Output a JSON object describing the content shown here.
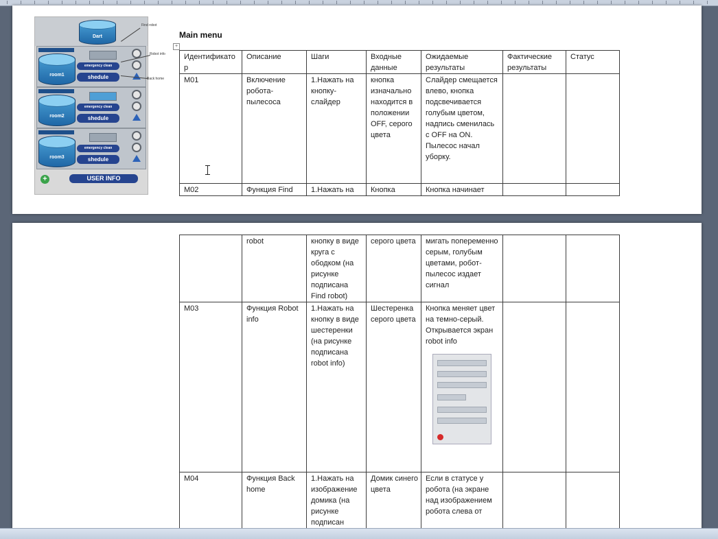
{
  "mockup": {
    "dart_label": "Dart",
    "rooms": [
      {
        "name": "room1",
        "button": "emergency clean",
        "schedule": "shedule"
      },
      {
        "name": "room2",
        "button": "emergency clean",
        "schedule": "shedule"
      },
      {
        "name": "room3",
        "button": "emergency clean",
        "schedule": "shedule"
      }
    ],
    "user_info": "USER INFO",
    "callouts": [
      "Find robot",
      "Robot info",
      "Back home"
    ]
  },
  "heading": "Main menu",
  "table": {
    "headers": [
      "Идентификатор",
      "Описание",
      "Шаги",
      "Входные данные",
      "Ожидаемые результаты",
      "Фактические результаты",
      "Статус"
    ],
    "page1_rows": [
      {
        "id": "M01",
        "desc": "Включение робота-пылесоса",
        "steps": "1.Нажать на кнопку-слайдер",
        "input": "кнопка изначально находится в положении OFF, серого цвета",
        "expected": "Слайдер смещается влево, кнопка подсвечивается голубым цветом, надпись сменилась с OFF на ON.",
        "expected2": "Пылесос начал уборку.",
        "actual": "",
        "status": ""
      },
      {
        "id": "M02",
        "desc": "Функция Find",
        "steps": "1.Нажать на",
        "input": "Кнопка",
        "expected": "Кнопка начинает",
        "actual": "",
        "status": ""
      }
    ],
    "page2_rows": [
      {
        "id": "",
        "desc": "robot",
        "steps": "кнопку в виде круга с ободком (на рисунке подписана Find robot)",
        "input": "серого цвета",
        "expected": "мигать попеременно серым, голубым цветами, робот-пылесос издает сигнал",
        "actual": "",
        "status": ""
      },
      {
        "id": "M03",
        "desc": "Функция Robot info",
        "steps": "1.Нажать на кнопку в виде шестеренки (на рисунке подписана robot info)",
        "input": "Шестеренка серого цвета",
        "expected": "Кнопка меняет цвет на темно-серый. Открывается экран robot info",
        "actual": "",
        "status": ""
      },
      {
        "id": "M04",
        "desc": "Функция Back home",
        "steps": "1.Нажать на изображение домика (на рисунке подписан",
        "input": "Домик синего цвета",
        "expected": "Если в статусе у робота (на экране над изображением робота слева от",
        "actual": "",
        "status": ""
      }
    ]
  }
}
